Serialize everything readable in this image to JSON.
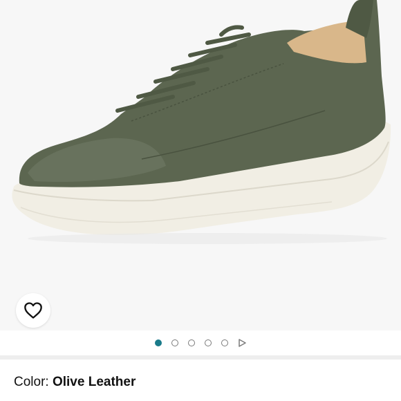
{
  "product": {
    "image_alt": "Olive leather low-top sneaker with white sole",
    "colors": {
      "leather": "#5c6650",
      "sole": "#f3f1e8",
      "lining": "#d9b78a",
      "accent": "#1b7b8a"
    }
  },
  "gallery": {
    "total_images": 5,
    "active_index": 0,
    "favorite_icon": "heart-icon",
    "next_icon": "play-icon"
  },
  "details": {
    "color_label": "Color:",
    "color_value": "Olive Leather"
  }
}
